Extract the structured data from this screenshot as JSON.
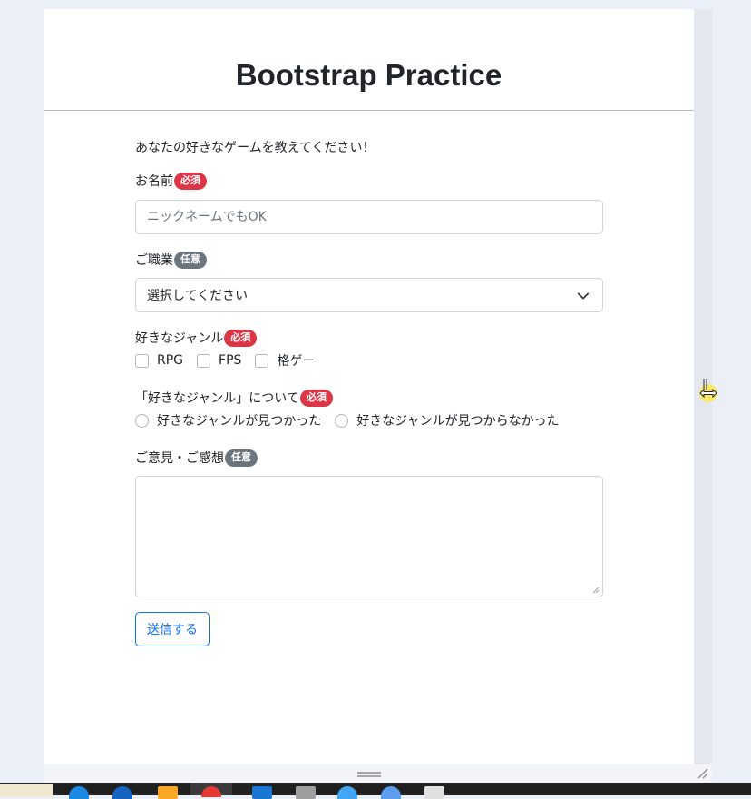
{
  "page": {
    "title": "Bootstrap Practice"
  },
  "form": {
    "lead": "あなたの好きなゲームを教えてください！",
    "name": {
      "label": "お名前",
      "badge": "必須",
      "placeholder": "ニックネームでもOK"
    },
    "job": {
      "label": "ご職業",
      "badge": "任意",
      "selected": "選択してください"
    },
    "genre": {
      "label": "好きなジャンル",
      "badge": "必須",
      "options": [
        "RPG",
        "FPS",
        "格ゲー"
      ]
    },
    "about_genre": {
      "label": "「好きなジャンル」について",
      "badge": "必須",
      "options": [
        "好きなジャンルが見つかった",
        "好きなジャンルが見つからなかった"
      ]
    },
    "comment": {
      "label": "ご意見・ご感想",
      "badge": "任意"
    },
    "submit_label": "送信する"
  },
  "colors": {
    "required_badge": "#dc3545",
    "optional_badge": "#6c757d",
    "primary": "#0d6efd"
  },
  "icons": {
    "select": "chevron-down-icon",
    "cursor": "resize-horizontal-cursor-icon"
  }
}
